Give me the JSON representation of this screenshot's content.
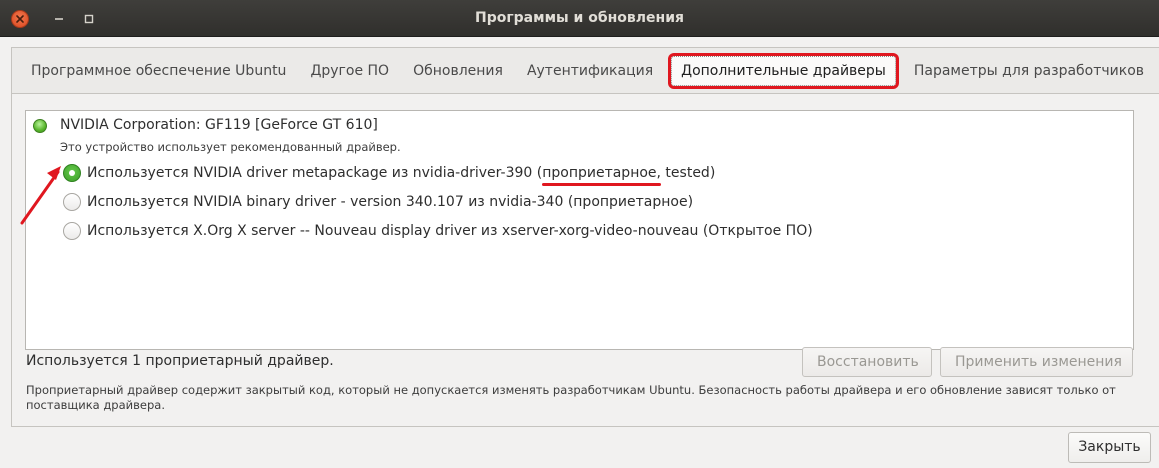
{
  "window": {
    "title": "Программы и обновления"
  },
  "tabs": [
    {
      "label": "Программное обеспечение Ubuntu",
      "active": false
    },
    {
      "label": "Другое ПО",
      "active": false
    },
    {
      "label": "Обновления",
      "active": false
    },
    {
      "label": "Аутентификация",
      "active": false
    },
    {
      "label": "Дополнительные драйверы",
      "active": true
    },
    {
      "label": "Параметры для разработчиков",
      "active": false
    }
  ],
  "device": {
    "name": "NVIDIA Corporation: GF119 [GeForce GT 610]",
    "note": "Это устройство использует рекомендованный драйвер."
  },
  "drivers": [
    {
      "prefix": "Используется NVIDIA driver metapackage из nvidia-driver-390 (",
      "highlight": "проприетарное",
      "suffix": ", tested)",
      "selected": true
    },
    {
      "label": "Используется NVIDIA binary driver - version 340.107 из nvidia-340 (проприетарное)",
      "selected": false
    },
    {
      "label": "Используется X.Org X server -- Nouveau display driver из xserver-xorg-video-nouveau (Открытое ПО)",
      "selected": false
    }
  ],
  "status_text": "Используется 1 проприетарный драйвер.",
  "buttons": {
    "restore": "Восстановить",
    "apply": "Применить изменения",
    "close": "Закрыть"
  },
  "footnote": "Проприетарный драйвер содержит закрытый код, который не допускается изменять разработчикам Ubuntu. Безопасность работы драйвера и его обновление зависят только от поставщика драйвера.",
  "colors": {
    "annotation": "#e0171f",
    "radio_selected": "#3d9f29"
  }
}
